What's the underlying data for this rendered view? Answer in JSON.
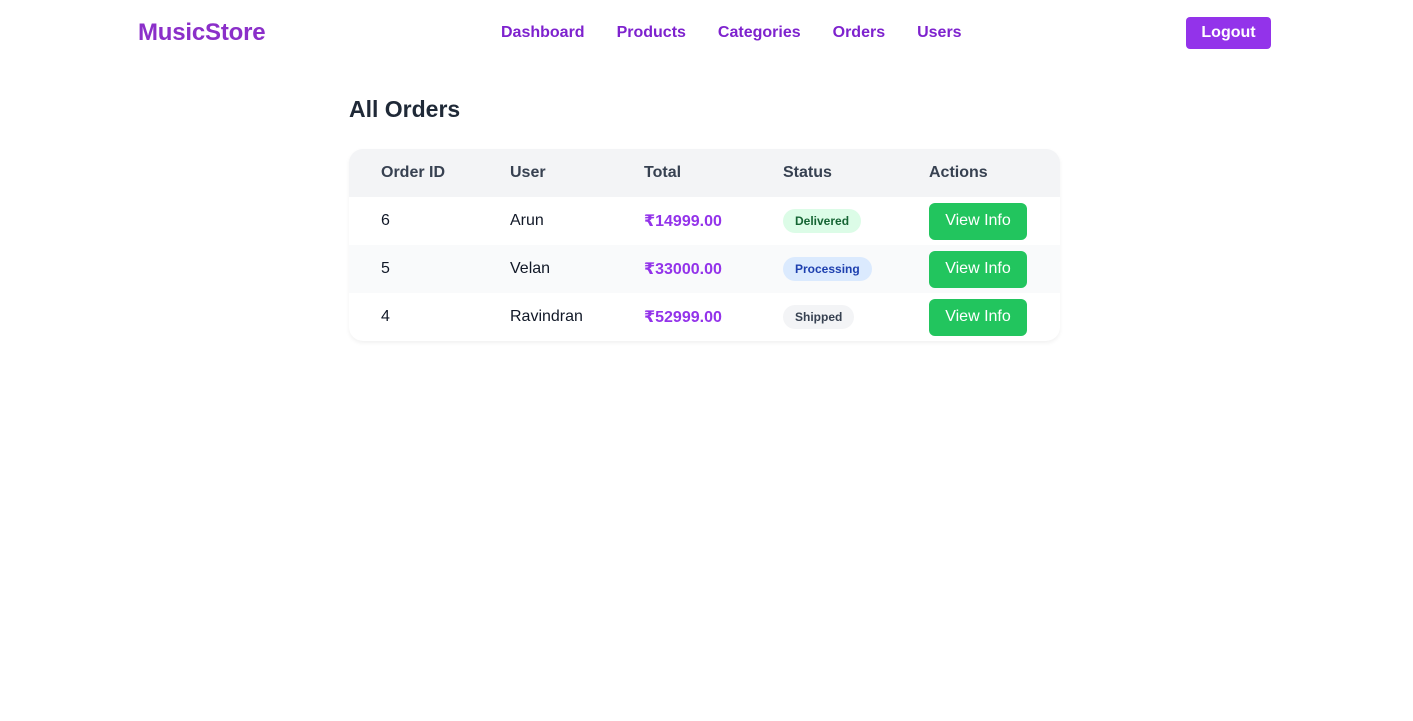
{
  "brand": "MusicStore",
  "nav": {
    "links": [
      "Dashboard",
      "Products",
      "Categories",
      "Orders",
      "Users"
    ],
    "logout_label": "Logout"
  },
  "page": {
    "title": "All Orders"
  },
  "table": {
    "headers": [
      "Order ID",
      "User",
      "Total",
      "Status",
      "Actions"
    ],
    "rows": [
      {
        "id": "6",
        "user": "Arun",
        "total": "₹14999.00",
        "status": "Delivered",
        "action": "View Info"
      },
      {
        "id": "5",
        "user": "Velan",
        "total": "₹33000.00",
        "status": "Processing",
        "action": "View Info"
      },
      {
        "id": "4",
        "user": "Ravindran",
        "total": "₹52999.00",
        "status": "Shipped",
        "action": "View Info"
      }
    ]
  },
  "colors": {
    "brand": "#8b2fc9",
    "accent": "#9333ea",
    "action_button": "#22c55e",
    "delivered_badge": "#dcfce7",
    "processing_badge": "#dbeafe",
    "shipped_badge": "#f3f4f6"
  }
}
